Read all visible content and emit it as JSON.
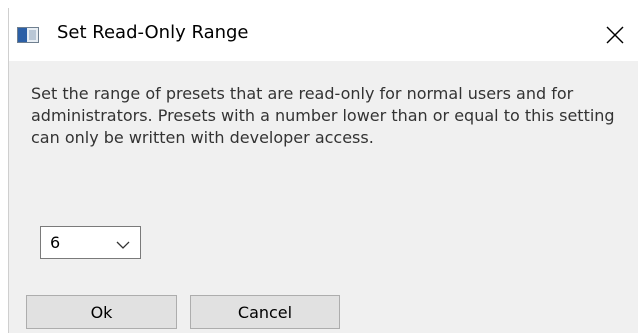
{
  "window": {
    "title": "Set Read-Only Range",
    "app_icon": "window-app-icon",
    "close_icon": "close-icon"
  },
  "dialog": {
    "description": "Set the range of presets that are read-only for normal users and for administrators. Presets with a number lower than or equal to this setting can only be written with developer access.",
    "range_select": {
      "selected_value": "6",
      "icon": "chevron-down-icon"
    },
    "buttons": {
      "ok_label": "Ok",
      "cancel_label": "Cancel"
    }
  },
  "colors": {
    "titlebar_bg": "#ffffff",
    "dialog_bg": "#f0f0f0",
    "button_bg": "#e1e1e1",
    "button_border": "#adadad",
    "text": "#333333"
  }
}
